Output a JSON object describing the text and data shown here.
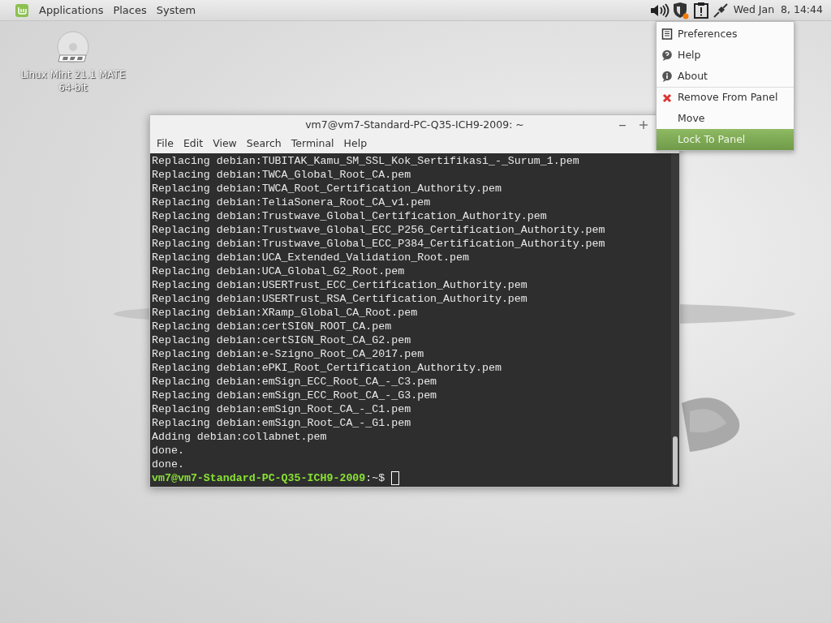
{
  "top_panel": {
    "menus": [
      "Applications",
      "Places",
      "System"
    ],
    "clock": "Wed Jan  8, 14:44"
  },
  "desktop_icons": [
    {
      "label": "Linux Mint 21.1 MATE 64-bit"
    }
  ],
  "terminal": {
    "title": "vm7@vm7-Standard-PC-Q35-ICH9-2009: ~",
    "menu": [
      "File",
      "Edit",
      "View",
      "Search",
      "Terminal",
      "Help"
    ],
    "lines": [
      "Replacing debian:TUBITAK_Kamu_SM_SSL_Kok_Sertifikasi_-_Surum_1.pem",
      "Replacing debian:TWCA_Global_Root_CA.pem",
      "Replacing debian:TWCA_Root_Certification_Authority.pem",
      "Replacing debian:TeliaSonera_Root_CA_v1.pem",
      "Replacing debian:Trustwave_Global_Certification_Authority.pem",
      "Replacing debian:Trustwave_Global_ECC_P256_Certification_Authority.pem",
      "Replacing debian:Trustwave_Global_ECC_P384_Certification_Authority.pem",
      "Replacing debian:UCA_Extended_Validation_Root.pem",
      "Replacing debian:UCA_Global_G2_Root.pem",
      "Replacing debian:USERTrust_ECC_Certification_Authority.pem",
      "Replacing debian:USERTrust_RSA_Certification_Authority.pem",
      "Replacing debian:XRamp_Global_CA_Root.pem",
      "Replacing debian:certSIGN_ROOT_CA.pem",
      "Replacing debian:certSIGN_Root_CA_G2.pem",
      "Replacing debian:e-Szigno_Root_CA_2017.pem",
      "Replacing debian:ePKI_Root_Certification_Authority.pem",
      "Replacing debian:emSign_ECC_Root_CA_-_C3.pem",
      "Replacing debian:emSign_ECC_Root_CA_-_G3.pem",
      "Replacing debian:emSign_Root_CA_-_C1.pem",
      "Replacing debian:emSign_Root_CA_-_G1.pem",
      "Adding debian:collabnet.pem",
      "done.",
      "done."
    ],
    "prompt": {
      "user_host": "vm7@vm7-Standard-PC-Q35-ICH9-2009",
      "path": ":~$"
    }
  },
  "context_menu": {
    "items": [
      {
        "label": "Preferences",
        "kind": "prefs",
        "separator_above": false,
        "selected": false
      },
      {
        "label": "Help",
        "kind": "help",
        "separator_above": false,
        "selected": false
      },
      {
        "label": "About",
        "kind": "about",
        "separator_above": false,
        "selected": false
      },
      {
        "label": "Remove From Panel",
        "kind": "remove",
        "separator_above": true,
        "selected": false
      },
      {
        "label": "Move",
        "kind": "plain",
        "separator_above": false,
        "selected": false
      },
      {
        "label": "Lock To Panel",
        "kind": "plain",
        "separator_above": false,
        "selected": true
      }
    ]
  }
}
